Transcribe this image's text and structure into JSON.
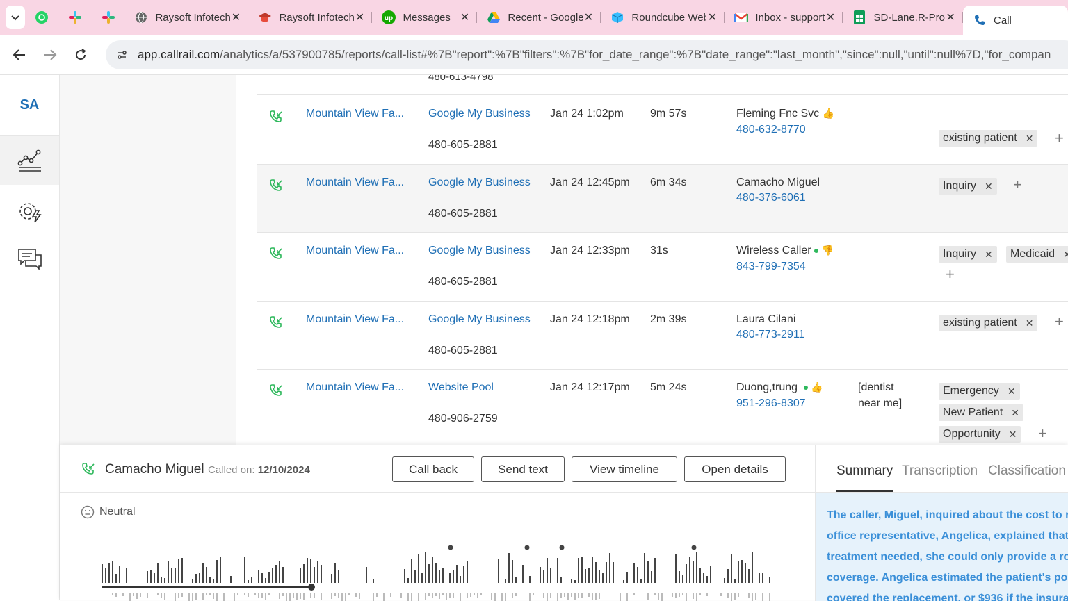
{
  "browser": {
    "tabs": [
      {
        "title": "Raysoft Infotech",
        "icon": "globe-icon"
      },
      {
        "title": "Raysoft Infotech",
        "icon": "graduation-cap-icon"
      },
      {
        "title": "Messages",
        "icon": "upwork-icon"
      },
      {
        "title": "Recent - Google Drive",
        "icon": "google-drive-icon"
      },
      {
        "title": "Roundcube Webmail",
        "icon": "roundcube-icon"
      },
      {
        "title": "Inbox - support",
        "icon": "gmail-icon"
      },
      {
        "title": "SD-Lane.R-Pro",
        "icon": "google-sheets-icon"
      },
      {
        "title": "Call",
        "icon": "callrail-icon"
      }
    ],
    "url_host": "app.callrail.com",
    "url_path": "/analytics/a/537900785/reports/call-list#%7B\"report\":%7B\"filters\":%7B\"for_date_range\":%7B\"date_range\":\"last_month\",\"since\":null,\"until\":null%7D,\"for_compan"
  },
  "sidebar": {
    "brand": "SA",
    "items": [
      {
        "name": "analytics",
        "icon": "analytics-chart-icon"
      },
      {
        "name": "settings",
        "icon": "gear-bolt-icon"
      },
      {
        "name": "conversations",
        "icon": "chat-bubbles-icon"
      }
    ]
  },
  "table": {
    "prev_row_number": "480-613-4798",
    "rows": [
      {
        "company": "Mountain View Fa...",
        "source": "Google My Business",
        "tracking_number": "480-605-2881",
        "start_time": "Jan 24 1:02pm",
        "duration": "9m 57s",
        "caller_name": "Fleming Fnc Svc",
        "caller_phone": "480-632-8770",
        "keyword": "",
        "tags": [
          "existing patient"
        ]
      },
      {
        "company": "Mountain View Fa...",
        "source": "Google My Business",
        "tracking_number": "480-605-2881",
        "start_time": "Jan 24 12:45pm",
        "duration": "6m 34s",
        "caller_name": "Camacho Miguel",
        "caller_phone": "480-376-6061",
        "keyword": "",
        "tags": [
          "Inquiry"
        ]
      },
      {
        "company": "Mountain View Fa...",
        "source": "Google My Business",
        "tracking_number": "480-605-2881",
        "start_time": "Jan 24 12:33pm",
        "duration": "31s",
        "caller_name": "Wireless Caller",
        "caller_phone": "843-799-7354",
        "keyword": "",
        "tags": [
          "Inquiry",
          "Medicaid"
        ]
      },
      {
        "company": "Mountain View Fa...",
        "source": "Google My Business",
        "tracking_number": "480-605-2881",
        "start_time": "Jan 24 12:18pm",
        "duration": "2m 39s",
        "caller_name": "Laura Cilani",
        "caller_phone": "480-773-2911",
        "keyword": "",
        "tags": [
          "existing patient"
        ]
      },
      {
        "company": "Mountain View Fa...",
        "source": "Website Pool",
        "tracking_number": "480-906-2759",
        "start_time": "Jan 24 12:17pm",
        "duration": "5m 24s",
        "caller_name": "Duong,trung",
        "caller_phone": "951-296-8307",
        "keyword_line1": "[dentist",
        "keyword_line2": "near me]",
        "tags": [
          "Emergency",
          "New Patient",
          "Opportunity"
        ]
      }
    ]
  },
  "panel": {
    "caller_name": "Camacho Miguel",
    "called_on_label": "Called on:",
    "called_on_date": "12/10/2024",
    "buttons": {
      "call_back": "Call back",
      "send_text": "Send text",
      "view_timeline": "View timeline",
      "open_details": "Open details"
    },
    "sentiment": "Neutral",
    "tabs": [
      "Summary",
      "Transcription",
      "Classification"
    ],
    "active_tab": "Summary",
    "summary_lines": [
      "The caller, Miguel, inquired about the cost to re",
      "office representative, Angelica, explained that",
      "treatment needed, she could only provide a rou",
      "coverage. Angelica estimated the patient's port",
      "covered the replacement, or $936 if the insura"
    ]
  },
  "colors": {
    "tab_strip": "#f9d6e4",
    "link": "#1f6fb5",
    "call_icon": "#2eb85c",
    "summary_bg": "#e6f2fb",
    "summary_text": "#3a8fd8"
  }
}
